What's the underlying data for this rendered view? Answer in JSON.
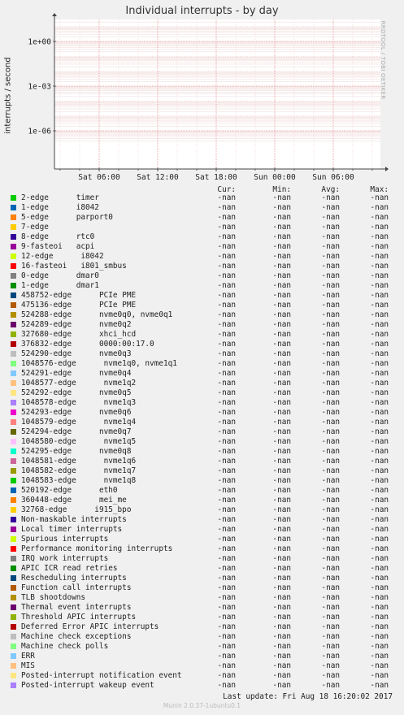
{
  "chart_data": {
    "type": "line",
    "title": "Individual interrupts - by day",
    "ylabel": "interrupts / second",
    "side_label": "RRDTOOL / TOBI OETIKER",
    "y_scale": "log",
    "y_ticks": [
      "1e+00",
      "1e-03",
      "1e-06"
    ],
    "x_ticks": [
      "Sat 06:00",
      "Sat 12:00",
      "Sat 18:00",
      "Sun 00:00",
      "Sun 06:00"
    ],
    "grid": true,
    "columns": [
      "Cur:",
      "Min:",
      "Avg:",
      "Max:"
    ],
    "series": [
      {
        "name": "2-edge      timer",
        "color": "#00cc00",
        "cur": "-nan",
        "min": "-nan",
        "avg": "-nan",
        "max": "-nan"
      },
      {
        "name": "1-edge      i8042",
        "color": "#0066b3",
        "cur": "-nan",
        "min": "-nan",
        "avg": "-nan",
        "max": "-nan"
      },
      {
        "name": "5-edge      parport0",
        "color": "#ff8000",
        "cur": "-nan",
        "min": "-nan",
        "avg": "-nan",
        "max": "-nan"
      },
      {
        "name": "7-edge",
        "color": "#ffcc00",
        "cur": "-nan",
        "min": "-nan",
        "avg": "-nan",
        "max": "-nan"
      },
      {
        "name": "8-edge      rtc0",
        "color": "#330099",
        "cur": "-nan",
        "min": "-nan",
        "avg": "-nan",
        "max": "-nan"
      },
      {
        "name": "9-fasteoi   acpi",
        "color": "#990099",
        "cur": "-nan",
        "min": "-nan",
        "avg": "-nan",
        "max": "-nan"
      },
      {
        "name": "12-edge      i8042",
        "color": "#ccff00",
        "cur": "-nan",
        "min": "-nan",
        "avg": "-nan",
        "max": "-nan"
      },
      {
        "name": "16-fasteoi   i801_smbus",
        "color": "#ff0000",
        "cur": "-nan",
        "min": "-nan",
        "avg": "-nan",
        "max": "-nan"
      },
      {
        "name": "0-edge      dmar0",
        "color": "#808080",
        "cur": "-nan",
        "min": "-nan",
        "avg": "-nan",
        "max": "-nan"
      },
      {
        "name": "1-edge      dmar1",
        "color": "#008f00",
        "cur": "-nan",
        "min": "-nan",
        "avg": "-nan",
        "max": "-nan"
      },
      {
        "name": "458752-edge      PCIe PME",
        "color": "#00487d",
        "cur": "-nan",
        "min": "-nan",
        "avg": "-nan",
        "max": "-nan"
      },
      {
        "name": "475136-edge      PCIe PME",
        "color": "#b35a00",
        "cur": "-nan",
        "min": "-nan",
        "avg": "-nan",
        "max": "-nan"
      },
      {
        "name": "524288-edge      nvme0q0, nvme0q1",
        "color": "#b38f00",
        "cur": "-nan",
        "min": "-nan",
        "avg": "-nan",
        "max": "-nan"
      },
      {
        "name": "524289-edge      nvme0q2",
        "color": "#6b006b",
        "cur": "-nan",
        "min": "-nan",
        "avg": "-nan",
        "max": "-nan"
      },
      {
        "name": "327680-edge      xhci_hcd",
        "color": "#8fb300",
        "cur": "-nan",
        "min": "-nan",
        "avg": "-nan",
        "max": "-nan"
      },
      {
        "name": "376832-edge      0000:00:17.0",
        "color": "#b30000",
        "cur": "-nan",
        "min": "-nan",
        "avg": "-nan",
        "max": "-nan"
      },
      {
        "name": "524290-edge      nvme0q3",
        "color": "#bebebe",
        "cur": "-nan",
        "min": "-nan",
        "avg": "-nan",
        "max": "-nan"
      },
      {
        "name": "1048576-edge      nvme1q0, nvme1q1",
        "color": "#80ff80",
        "cur": "-nan",
        "min": "-nan",
        "avg": "-nan",
        "max": "-nan"
      },
      {
        "name": "524291-edge      nvme0q4",
        "color": "#80c9ff",
        "cur": "-nan",
        "min": "-nan",
        "avg": "-nan",
        "max": "-nan"
      },
      {
        "name": "1048577-edge      nvme1q2",
        "color": "#ffc080",
        "cur": "-nan",
        "min": "-nan",
        "avg": "-nan",
        "max": "-nan"
      },
      {
        "name": "524292-edge      nvme0q5",
        "color": "#ffe680",
        "cur": "-nan",
        "min": "-nan",
        "avg": "-nan",
        "max": "-nan"
      },
      {
        "name": "1048578-edge      nvme1q3",
        "color": "#aa80ff",
        "cur": "-nan",
        "min": "-nan",
        "avg": "-nan",
        "max": "-nan"
      },
      {
        "name": "524293-edge      nvme0q6",
        "color": "#ee00cc",
        "cur": "-nan",
        "min": "-nan",
        "avg": "-nan",
        "max": "-nan"
      },
      {
        "name": "1048579-edge      nvme1q4",
        "color": "#ff8080",
        "cur": "-nan",
        "min": "-nan",
        "avg": "-nan",
        "max": "-nan"
      },
      {
        "name": "524294-edge      nvme0q7",
        "color": "#666600",
        "cur": "-nan",
        "min": "-nan",
        "avg": "-nan",
        "max": "-nan"
      },
      {
        "name": "1048580-edge      nvme1q5",
        "color": "#ffbfff",
        "cur": "-nan",
        "min": "-nan",
        "avg": "-nan",
        "max": "-nan"
      },
      {
        "name": "524295-edge      nvme0q8",
        "color": "#00ffcc",
        "cur": "-nan",
        "min": "-nan",
        "avg": "-nan",
        "max": "-nan"
      },
      {
        "name": "1048581-edge      nvme1q6",
        "color": "#cc6699",
        "cur": "-nan",
        "min": "-nan",
        "avg": "-nan",
        "max": "-nan"
      },
      {
        "name": "1048582-edge      nvme1q7",
        "color": "#999900",
        "cur": "-nan",
        "min": "-nan",
        "avg": "-nan",
        "max": "-nan"
      },
      {
        "name": "1048583-edge      nvme1q8",
        "color": "#00cc00",
        "cur": "-nan",
        "min": "-nan",
        "avg": "-nan",
        "max": "-nan"
      },
      {
        "name": "520192-edge      eth0",
        "color": "#0066b3",
        "cur": "-nan",
        "min": "-nan",
        "avg": "-nan",
        "max": "-nan"
      },
      {
        "name": "360448-edge      mei_me",
        "color": "#ff8000",
        "cur": "-nan",
        "min": "-nan",
        "avg": "-nan",
        "max": "-nan"
      },
      {
        "name": "32768-edge      i915_bpo",
        "color": "#ffcc00",
        "cur": "-nan",
        "min": "-nan",
        "avg": "-nan",
        "max": "-nan"
      },
      {
        "name": "Non-maskable interrupts",
        "color": "#330099",
        "cur": "-nan",
        "min": "-nan",
        "avg": "-nan",
        "max": "-nan"
      },
      {
        "name": "Local timer interrupts",
        "color": "#990099",
        "cur": "-nan",
        "min": "-nan",
        "avg": "-nan",
        "max": "-nan"
      },
      {
        "name": "Spurious interrupts",
        "color": "#ccff00",
        "cur": "-nan",
        "min": "-nan",
        "avg": "-nan",
        "max": "-nan"
      },
      {
        "name": "Performance monitoring interrupts",
        "color": "#ff0000",
        "cur": "-nan",
        "min": "-nan",
        "avg": "-nan",
        "max": "-nan"
      },
      {
        "name": "IRQ work interrupts",
        "color": "#808080",
        "cur": "-nan",
        "min": "-nan",
        "avg": "-nan",
        "max": "-nan"
      },
      {
        "name": "APIC ICR read retries",
        "color": "#008f00",
        "cur": "-nan",
        "min": "-nan",
        "avg": "-nan",
        "max": "-nan"
      },
      {
        "name": "Rescheduling interrupts",
        "color": "#00487d",
        "cur": "-nan",
        "min": "-nan",
        "avg": "-nan",
        "max": "-nan"
      },
      {
        "name": "Function call interrupts",
        "color": "#b35a00",
        "cur": "-nan",
        "min": "-nan",
        "avg": "-nan",
        "max": "-nan"
      },
      {
        "name": "TLB shootdowns",
        "color": "#b38f00",
        "cur": "-nan",
        "min": "-nan",
        "avg": "-nan",
        "max": "-nan"
      },
      {
        "name": "Thermal event interrupts",
        "color": "#6b006b",
        "cur": "-nan",
        "min": "-nan",
        "avg": "-nan",
        "max": "-nan"
      },
      {
        "name": "Threshold APIC interrupts",
        "color": "#8fb300",
        "cur": "-nan",
        "min": "-nan",
        "avg": "-nan",
        "max": "-nan"
      },
      {
        "name": "Deferred Error APIC interrupts",
        "color": "#b30000",
        "cur": "-nan",
        "min": "-nan",
        "avg": "-nan",
        "max": "-nan"
      },
      {
        "name": "Machine check exceptions",
        "color": "#bebebe",
        "cur": "-nan",
        "min": "-nan",
        "avg": "-nan",
        "max": "-nan"
      },
      {
        "name": "Machine check polls",
        "color": "#80ff80",
        "cur": "-nan",
        "min": "-nan",
        "avg": "-nan",
        "max": "-nan"
      },
      {
        "name": "ERR",
        "color": "#80c9ff",
        "cur": "-nan",
        "min": "-nan",
        "avg": "-nan",
        "max": "-nan"
      },
      {
        "name": "MIS",
        "color": "#ffc080",
        "cur": "-nan",
        "min": "-nan",
        "avg": "-nan",
        "max": "-nan"
      },
      {
        "name": "Posted-interrupt notification event",
        "color": "#ffe680",
        "cur": "-nan",
        "min": "-nan",
        "avg": "-nan",
        "max": "-nan"
      },
      {
        "name": "Posted-interrupt wakeup event",
        "color": "#aa80ff",
        "cur": "-nan",
        "min": "-nan",
        "avg": "-nan",
        "max": "-nan"
      }
    ]
  },
  "footer": {
    "last_update": "Last update: Fri Aug 18 16:20:02 2017",
    "munin_version": "Munin 2.0.37-1ubuntu0.1"
  }
}
